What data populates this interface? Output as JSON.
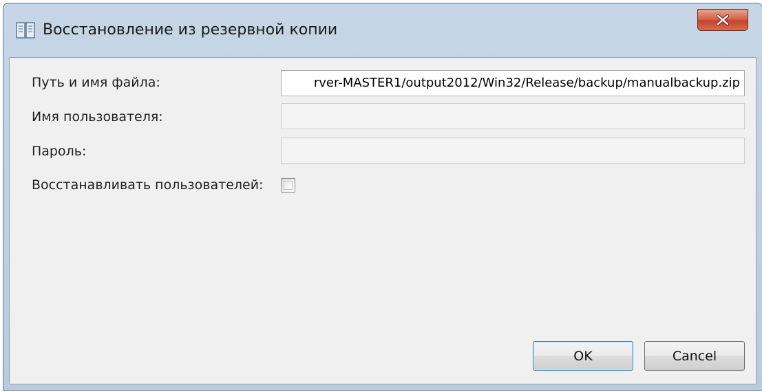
{
  "window": {
    "title": "Восстановление из резервной копии",
    "app_icon": "book-icon",
    "close_icon": "close-icon"
  },
  "form": {
    "path_label": "Путь и имя файла:",
    "path_value": "rver-MASTER1/output2012/Win32/Release/backup/manualbackup.zip",
    "username_label": "Имя пользователя:",
    "username_value": "",
    "password_label": "Пароль:",
    "password_value": "",
    "restore_users_label": "Восстанавливать пользователей:",
    "restore_users_checked": false
  },
  "buttons": {
    "ok_label": "OK",
    "cancel_label": "Cancel"
  },
  "colors": {
    "close_button": "#c3442c",
    "title_bar": "#c6d6e6"
  }
}
